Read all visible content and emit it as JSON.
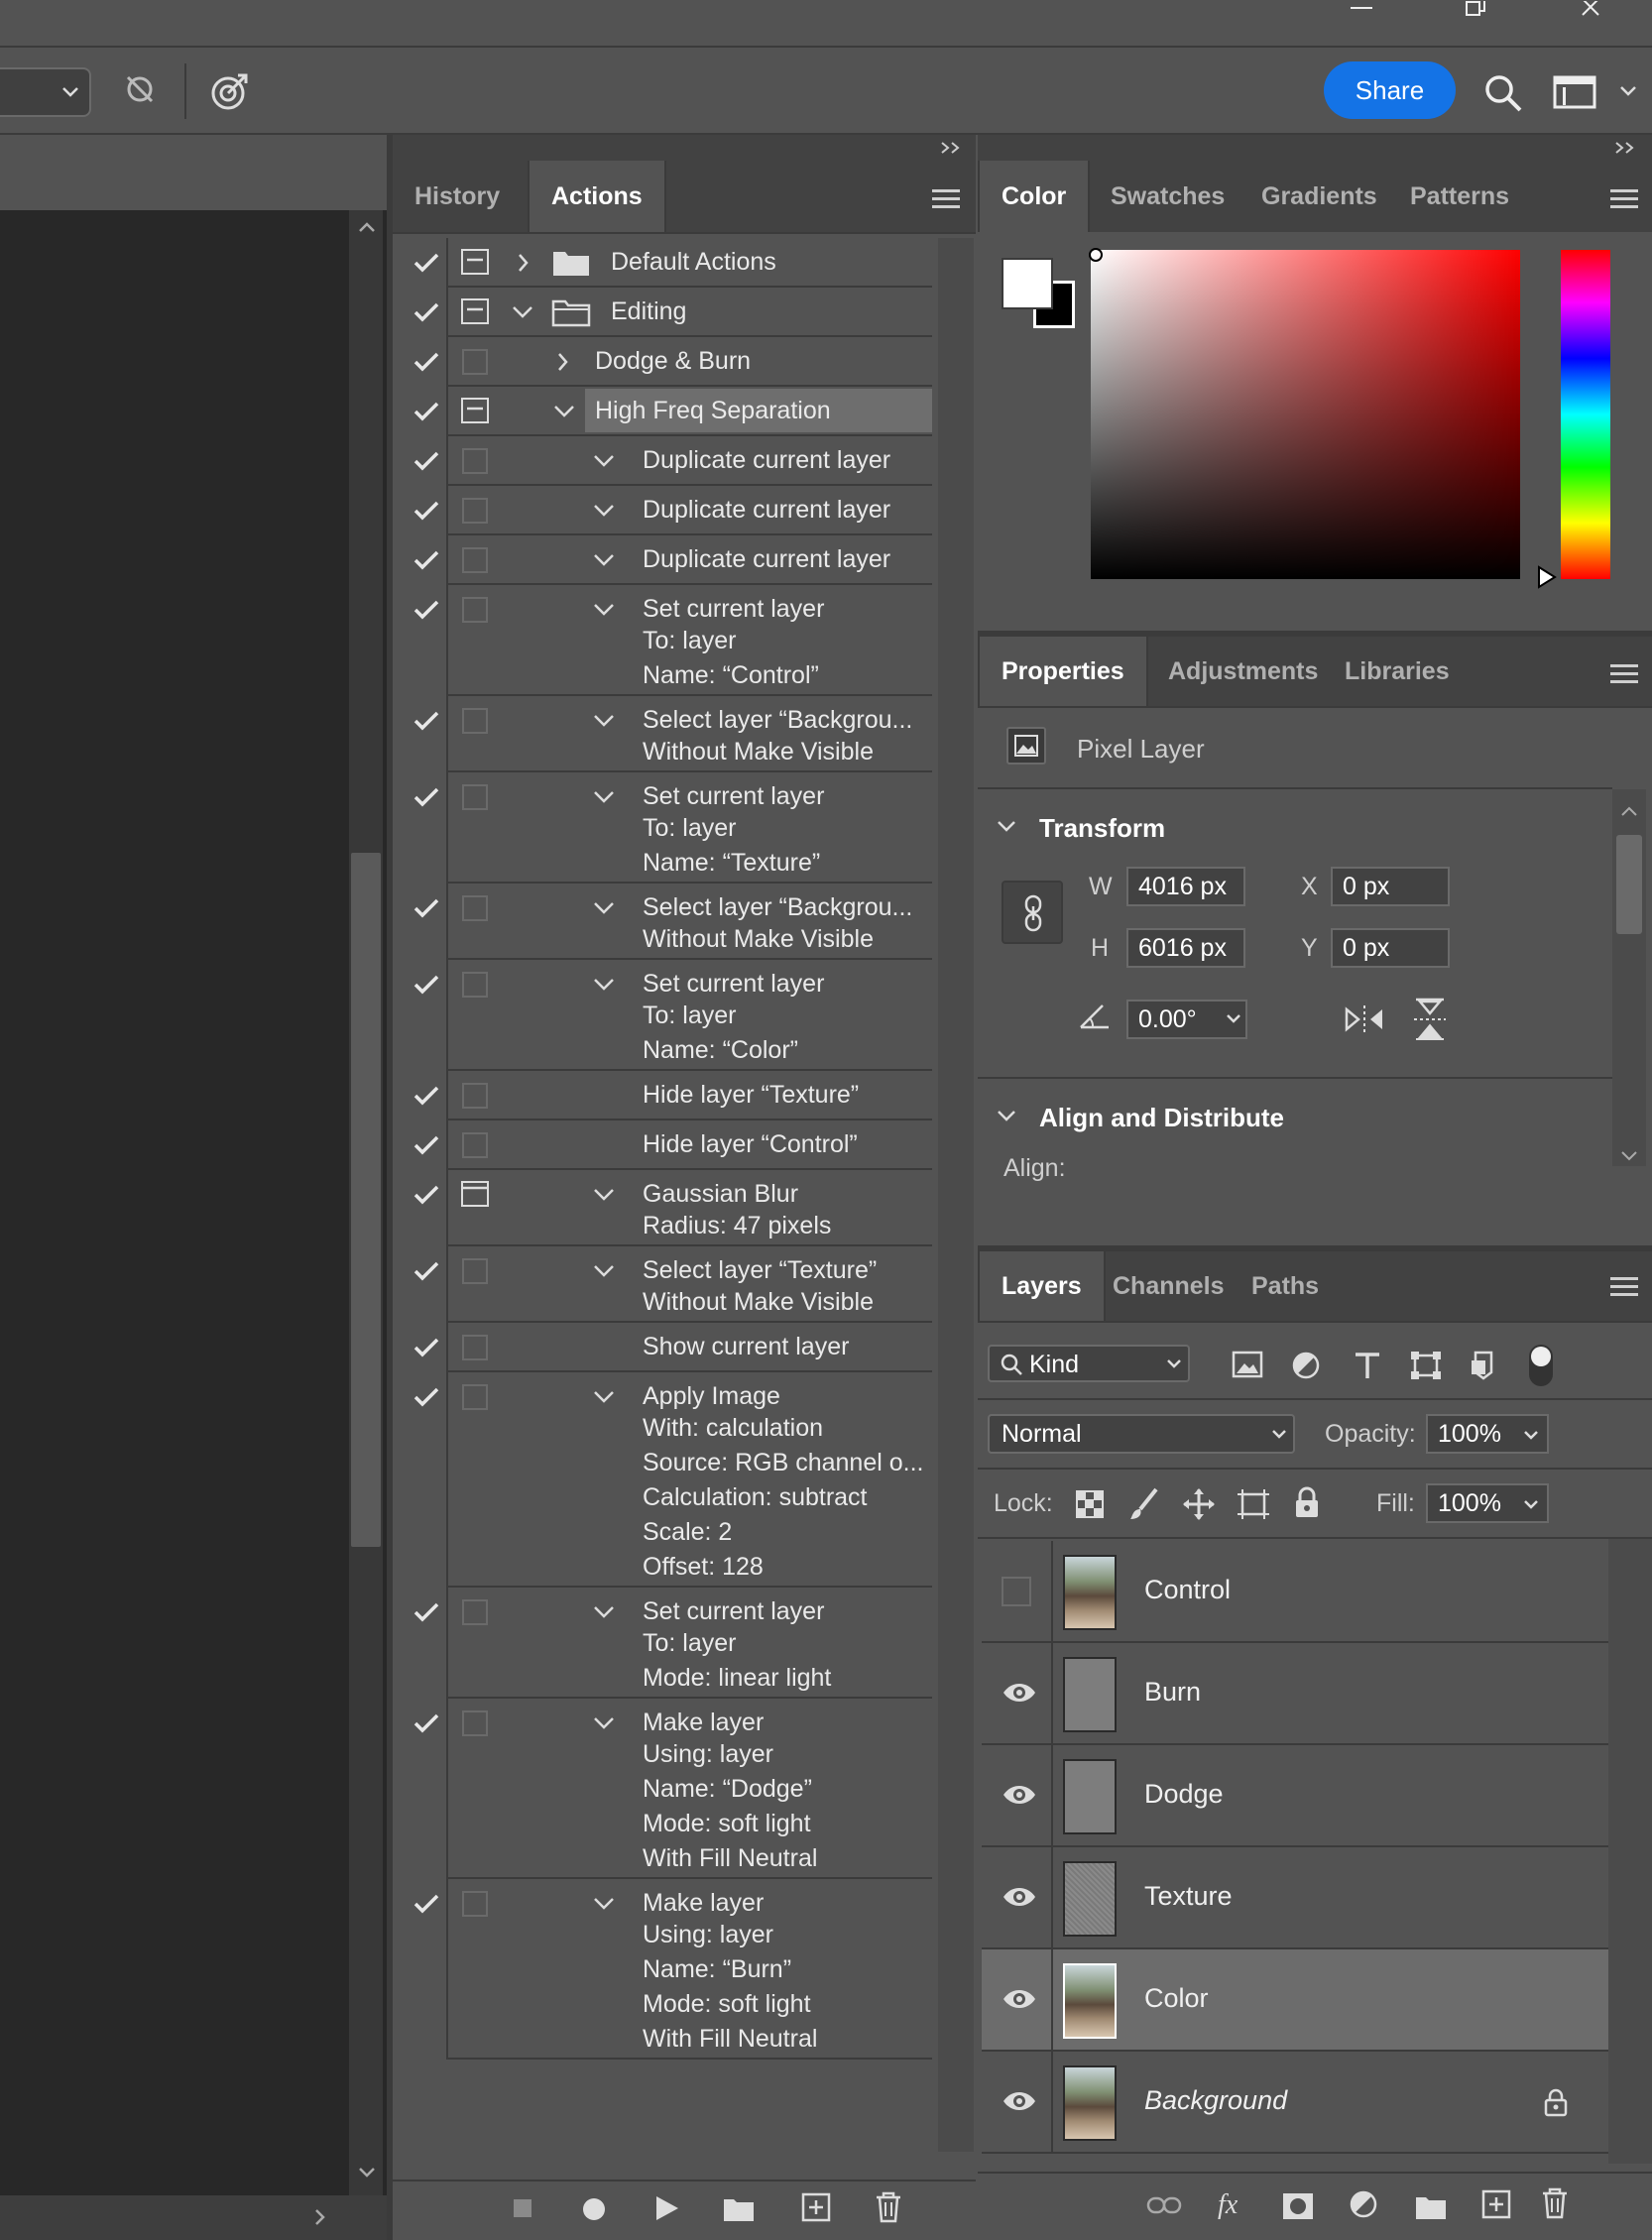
{
  "window": {
    "minimize": "—",
    "restore": "❐",
    "close": "✕"
  },
  "toolbar": {
    "share_label": "Share"
  },
  "actions_panel": {
    "tabs": [
      "History",
      "Actions"
    ],
    "active_tab": "Actions",
    "rows": [
      {
        "text": "Default Actions"
      },
      {
        "text": "Editing"
      },
      {
        "text": "Dodge & Burn"
      },
      {
        "text": "High Freq Separation"
      },
      {
        "text": "Duplicate current layer"
      },
      {
        "text": "Duplicate current layer"
      },
      {
        "text": "Duplicate current layer"
      },
      {
        "text": "Set current layer",
        "details": [
          "To: layer",
          "Name:  “Control”"
        ]
      },
      {
        "text": "Select layer “Backgrou...",
        "details": [
          "Without Make Visible"
        ]
      },
      {
        "text": "Set current layer",
        "details": [
          "To: layer",
          "Name:  “Texture”"
        ]
      },
      {
        "text": "Select layer “Backgrou...",
        "details": [
          "Without Make Visible"
        ]
      },
      {
        "text": "Set current layer",
        "details": [
          "To: layer",
          "Name:  “Color”"
        ]
      },
      {
        "text": "Hide layer “Texture”"
      },
      {
        "text": "Hide layer “Control”"
      },
      {
        "text": "Gaussian Blur",
        "details": [
          "Radius: 47 pixels"
        ]
      },
      {
        "text": "Select layer “Texture”",
        "details": [
          "Without Make Visible"
        ]
      },
      {
        "text": "Show current layer"
      },
      {
        "text": "Apply Image",
        "details": [
          "With: calculation",
          "Source: RGB channel o...",
          "Calculation: subtract",
          "Scale: 2",
          "Offset: 128"
        ]
      },
      {
        "text": "Set current layer",
        "details": [
          "To: layer",
          "Mode: linear light"
        ]
      },
      {
        "text": "Make layer",
        "details": [
          "Using: layer",
          "Name:  “Dodge”",
          "Mode: soft light",
          "With Fill Neutral"
        ]
      },
      {
        "text": "Make layer",
        "details": [
          "Using: layer",
          "Name:  “Burn”",
          "Mode: soft light",
          "With Fill Neutral"
        ]
      }
    ]
  },
  "color_panel": {
    "tabs": [
      "Color",
      "Swatches",
      "Gradients",
      "Patterns"
    ],
    "foreground": "#ffffff",
    "background": "#000000"
  },
  "properties_panel": {
    "tabs": [
      "Properties",
      "Adjustments",
      "Libraries"
    ],
    "layer_kind": "Pixel Layer",
    "transform_title": "Transform",
    "w_label": "W",
    "w_value": "4016 px",
    "h_label": "H",
    "h_value": "6016 px",
    "x_label": "X",
    "x_value": "0 px",
    "y_label": "Y",
    "y_value": "0 px",
    "angle_value": "0.00°",
    "align_title": "Align and Distribute",
    "align_label": "Align:"
  },
  "layers_panel": {
    "tabs": [
      "Layers",
      "Channels",
      "Paths"
    ],
    "filter_kind": "Kind",
    "blend_mode": "Normal",
    "opacity_label": "Opacity:",
    "opacity_value": "100%",
    "lock_label": "Lock:",
    "fill_label": "Fill:",
    "fill_value": "100%",
    "layers": [
      {
        "name": "Control",
        "visible": false,
        "thumb": "photo"
      },
      {
        "name": "Burn",
        "visible": true,
        "thumb": "gray"
      },
      {
        "name": "Dodge",
        "visible": true,
        "thumb": "gray"
      },
      {
        "name": "Texture",
        "visible": true,
        "thumb": "noise"
      },
      {
        "name": "Color",
        "visible": true,
        "thumb": "photo",
        "selected": true
      },
      {
        "name": "Background",
        "visible": true,
        "thumb": "photo",
        "locked": true
      }
    ]
  }
}
